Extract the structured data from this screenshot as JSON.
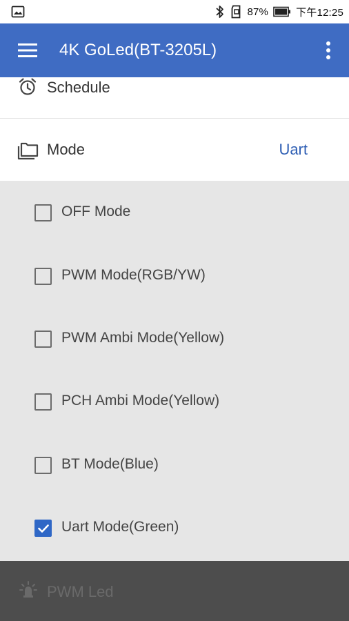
{
  "status_bar": {
    "battery_percent": "87%",
    "time": "下午12:25",
    "icons": [
      "image-icon",
      "bluetooth-icon",
      "sd-card-icon",
      "battery-icon"
    ]
  },
  "app_bar": {
    "title": "4K GoLed(BT-3205L)",
    "background_color": "#3f6cc3",
    "icons": [
      "menu-icon",
      "more-vert-icon"
    ]
  },
  "settings": {
    "schedule": {
      "label": "Schedule",
      "icon": "alarm-clock-icon"
    },
    "mode": {
      "label": "Mode",
      "value": "Uart",
      "icon": "folders-icon"
    }
  },
  "mode_options": [
    {
      "label": "OFF Mode",
      "checked": false
    },
    {
      "label": "PWM Mode(RGB/YW)",
      "checked": false
    },
    {
      "label": "PWM Ambi Mode(Yellow)",
      "checked": false
    },
    {
      "label": "PCH Ambi Mode(Yellow)",
      "checked": false
    },
    {
      "label": "BT Mode(Blue)",
      "checked": false
    },
    {
      "label": "Uart Mode(Green)",
      "checked": true
    }
  ],
  "bottom_item": {
    "label": "PWM Led",
    "icon": "led-icon",
    "disabled": true
  },
  "colors": {
    "accent": "#2f67c6",
    "panel_background": "#e6e6e6",
    "bottom_background": "#4d4d4d"
  }
}
